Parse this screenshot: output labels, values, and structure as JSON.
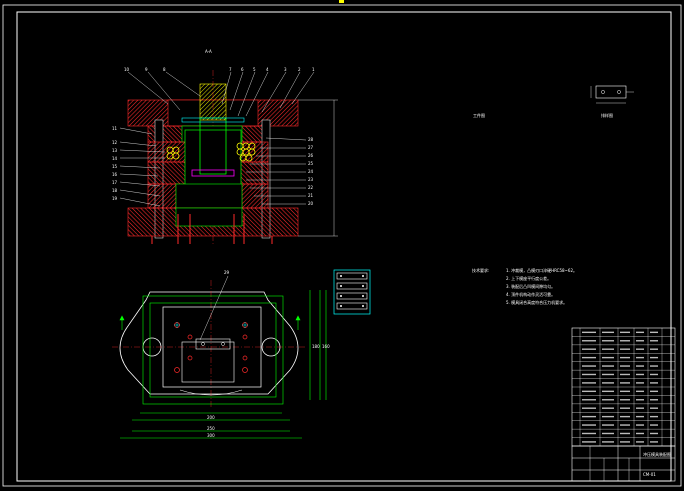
{
  "section_label": "A-A",
  "view_labels": {
    "workpiece": "工件图",
    "layout": "排样图"
  },
  "leader_numbers_top": [
    "10",
    "9",
    "8",
    "7",
    "6",
    "5",
    "4",
    "3",
    "2",
    "1"
  ],
  "leader_numbers_left": [
    "11",
    "12",
    "13",
    "14",
    "15",
    "16",
    "17",
    "18",
    "19"
  ],
  "leader_numbers_right": [
    "28",
    "27",
    "26",
    "25",
    "24",
    "23",
    "22",
    "21",
    "20"
  ],
  "plan_view_callout": "29",
  "plan_dims": {
    "d1": "300",
    "d2": "250",
    "d3": "200",
    "d4": "180",
    "d5": "160"
  },
  "tech_req": {
    "title": "技术要求:",
    "items": [
      "1. 冲裁模，凸模刃口淬硬HRC58~62。",
      "2. 上下模座平行度公差。",
      "3. 装配后凸凹模间隙均匀。",
      "4. 顶件机构动作灵活可靠。",
      "5. 模具闭合高度符合压力机要求。"
    ]
  },
  "title_block": {
    "drawing_no": "CM-01",
    "title": "冲压模具装配图"
  },
  "colors": {
    "background": "#000000",
    "frame": "#ffffff",
    "hatch": "#ff0000",
    "outline": "#00ff00",
    "dim": "#ffffff",
    "accent": "#ffff00",
    "part": "#ff00ff",
    "cyan": "#00ffff"
  }
}
